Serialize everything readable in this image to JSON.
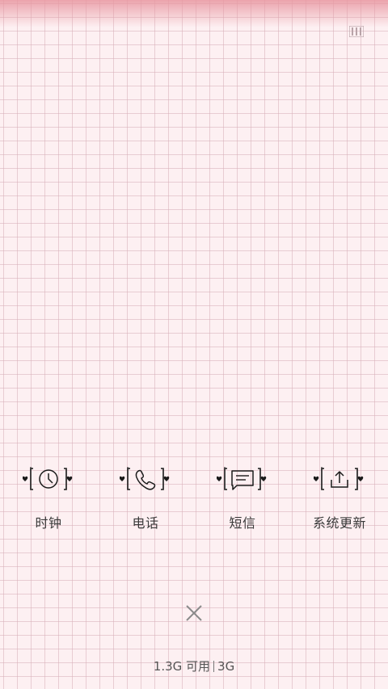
{
  "header": {
    "menu_icon": "recent-apps-icon"
  },
  "apps": [
    {
      "label": "时钟",
      "icon": "clock-icon"
    },
    {
      "label": "电话",
      "icon": "phone-icon"
    },
    {
      "label": "短信",
      "icon": "message-icon"
    },
    {
      "label": "系统更新",
      "icon": "system-update-icon"
    }
  ],
  "close": {
    "icon": "close-icon"
  },
  "memory": {
    "available": "1.3G 可用",
    "total": "3G"
  },
  "colors": {
    "background": "#fdf0f2",
    "grid": "#d7afb9",
    "top_glow": "#e896a0",
    "icon": "#1a1a1a",
    "text": "#3a3a3a"
  }
}
